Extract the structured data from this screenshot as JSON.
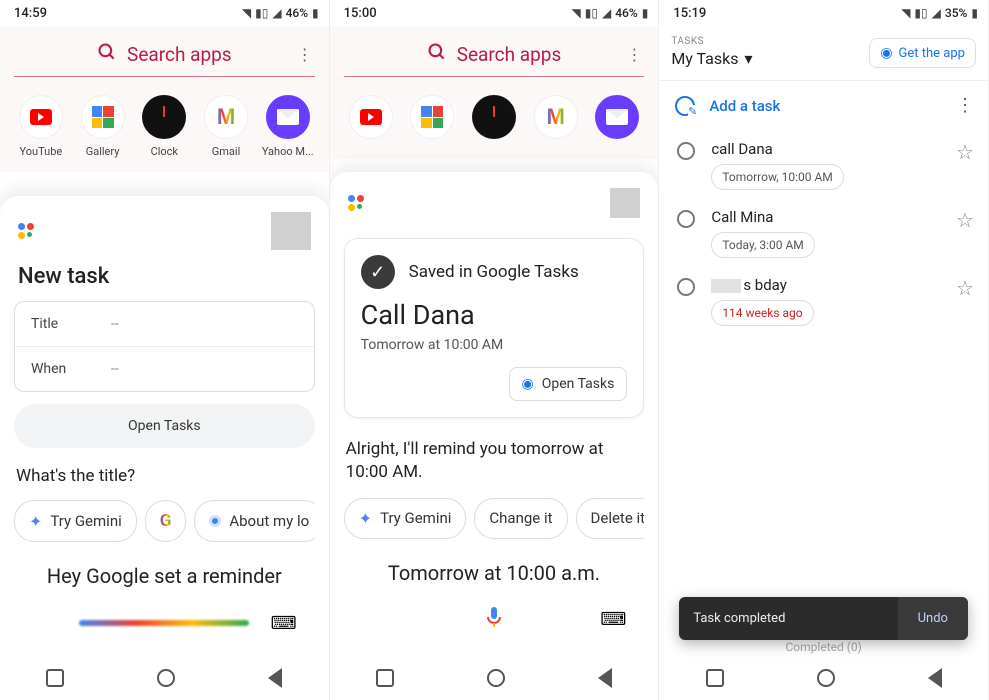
{
  "s1": {
    "status": {
      "time": "14:59",
      "battery": "46%"
    },
    "search": "Search apps",
    "apps": {
      "yt": "YouTube",
      "ga": "Gallery",
      "cl": "Clock",
      "gm": "Gmail",
      "ym": "Yahoo M..."
    },
    "new_task": "New task",
    "form": {
      "title_lbl": "Title",
      "title_val": "--",
      "when_lbl": "When",
      "when_val": "--"
    },
    "open_tasks": "Open Tasks",
    "prompt": "What's the title?",
    "chips": {
      "gemini": "Try Gemini",
      "about": "About my lo"
    },
    "spoken": "Hey Google set a reminder"
  },
  "s2": {
    "status": {
      "time": "15:00",
      "battery": "46%"
    },
    "search": "Search apps",
    "card": {
      "saved": "Saved in Google Tasks",
      "title": "Call Dana",
      "when": "Tomorrow at 10:00 AM",
      "open": "Open Tasks"
    },
    "response": "Alright, I'll remind you tomorrow at 10:00 AM.",
    "chips": {
      "gemini": "Try Gemini",
      "change": "Change it",
      "delete": "Delete it"
    },
    "spoken": "Tomorrow at 10:00 a.m."
  },
  "s3": {
    "status": {
      "time": "15:19",
      "battery": "35%"
    },
    "header": {
      "tasks_lbl": "TASKS",
      "list": "My Tasks",
      "get_app": "Get the app"
    },
    "add_task": "Add a task",
    "tasks": [
      {
        "title": "call Dana",
        "chip": "Tomorrow, 10:00 AM",
        "overdue": false
      },
      {
        "title": "Call Mina",
        "chip": "Today, 3:00 AM",
        "overdue": false
      },
      {
        "title": "s bday",
        "chip": "114 weeks ago",
        "overdue": true,
        "blurred": true
      }
    ],
    "completed_hint": "Completed (0)",
    "snackbar": {
      "msg": "Task completed",
      "undo": "Undo"
    }
  }
}
